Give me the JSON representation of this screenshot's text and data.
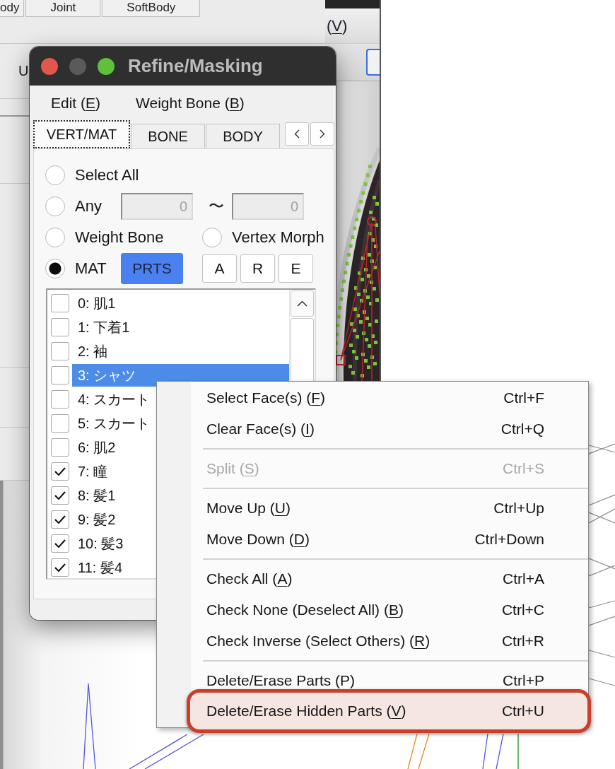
{
  "background_window": {
    "tabs": [
      {
        "label": "ody",
        "selected": false
      },
      {
        "label": "Joint",
        "selected": false
      },
      {
        "label": "SoftBody",
        "selected": false
      }
    ],
    "label": "U"
  },
  "viewer_window": {
    "menu": [
      {
        "label": "(V)",
        "mnemonic_underlined": true
      }
    ]
  },
  "dialog": {
    "title": "Refine/Masking",
    "menu": [
      {
        "label": "Edit (E)",
        "mnemonic_underlined": true
      },
      {
        "label": "Weight Bone (B)",
        "mnemonic_underlined": true
      }
    ],
    "tabs": [
      {
        "label": "VERT/MAT",
        "selected": true
      },
      {
        "label": "BONE",
        "selected": false
      },
      {
        "label": "BODY",
        "selected": false
      }
    ],
    "option_rows": [
      {
        "items": [
          {
            "kind": "radio",
            "label": "Select All",
            "selected": false
          }
        ]
      },
      {
        "items": [
          {
            "kind": "radio",
            "label": "Any",
            "selected": false
          },
          {
            "kind": "field",
            "value": "0",
            "disabled": true
          },
          {
            "kind": "text",
            "label": "〜"
          },
          {
            "kind": "field",
            "value": "0",
            "disabled": true
          }
        ]
      },
      {
        "items": [
          {
            "kind": "radio",
            "label": "Weight Bone",
            "selected": false
          },
          {
            "kind": "radio",
            "label": "Vertex Morph",
            "selected": false
          }
        ]
      },
      {
        "items": [
          {
            "kind": "radio",
            "label": "MAT",
            "selected": true
          },
          {
            "kind": "toggle",
            "label": "PRTS",
            "on": true
          },
          {
            "kind": "button",
            "label": "A"
          },
          {
            "kind": "button",
            "label": "R"
          },
          {
            "kind": "button",
            "label": "E"
          }
        ]
      }
    ],
    "parts": [
      {
        "label": "0: 肌1",
        "checked": false,
        "selected": false
      },
      {
        "label": "1: 下着1",
        "checked": false,
        "selected": false
      },
      {
        "label": "2: 袖",
        "checked": false,
        "selected": false
      },
      {
        "label": "3: シャツ",
        "checked": false,
        "selected": true
      },
      {
        "label": "4: スカート",
        "checked": false,
        "selected": false
      },
      {
        "label": "5: スカート",
        "checked": false,
        "selected": false
      },
      {
        "label": "6: 肌2",
        "checked": false,
        "selected": false
      },
      {
        "label": "7: 瞳",
        "checked": true,
        "selected": false
      },
      {
        "label": "8: 髪1",
        "checked": true,
        "selected": false
      },
      {
        "label": "9: 髪2",
        "checked": true,
        "selected": false
      },
      {
        "label": "10: 髪3",
        "checked": true,
        "selected": false
      },
      {
        "label": "11: 髪4",
        "checked": true,
        "selected": false
      }
    ]
  },
  "context_menu": {
    "groups": [
      [
        {
          "label": "Select Face(s) (F)",
          "shortcut": "Ctrl+F",
          "disabled": false,
          "mnemonic_underlined": true,
          "annotated": false
        },
        {
          "label": "Clear Face(s) (I)",
          "shortcut": "Ctrl+Q",
          "disabled": false,
          "mnemonic_underlined": true,
          "annotated": false
        }
      ],
      [
        {
          "label": "Split (S)",
          "shortcut": "Ctrl+S",
          "disabled": true,
          "mnemonic_underlined": true,
          "annotated": false
        }
      ],
      [
        {
          "label": "Move Up (U)",
          "shortcut": "Ctrl+Up",
          "disabled": false,
          "mnemonic_underlined": true,
          "annotated": false
        },
        {
          "label": "Move Down (D)",
          "shortcut": "Ctrl+Down",
          "disabled": false,
          "mnemonic_underlined": true,
          "annotated": false
        }
      ],
      [
        {
          "label": "Check All (A)",
          "shortcut": "Ctrl+A",
          "disabled": false,
          "mnemonic_underlined": true,
          "annotated": false
        },
        {
          "label": "Check None (Deselect All) (B)",
          "shortcut": "Ctrl+C",
          "disabled": false,
          "mnemonic_underlined": true,
          "annotated": false
        },
        {
          "label": "Check Inverse (Select Others) (R)",
          "shortcut": "Ctrl+R",
          "disabled": false,
          "mnemonic_underlined": true,
          "annotated": false
        }
      ],
      [
        {
          "label": "Delete/Erase Parts (P)",
          "shortcut": "Ctrl+P",
          "disabled": false,
          "mnemonic_underlined": false,
          "annotated": false
        },
        {
          "label": "Delete/Erase Hidden Parts (V)",
          "shortcut": "Ctrl+U",
          "disabled": false,
          "mnemonic_underlined": true,
          "annotated": true
        }
      ]
    ]
  }
}
